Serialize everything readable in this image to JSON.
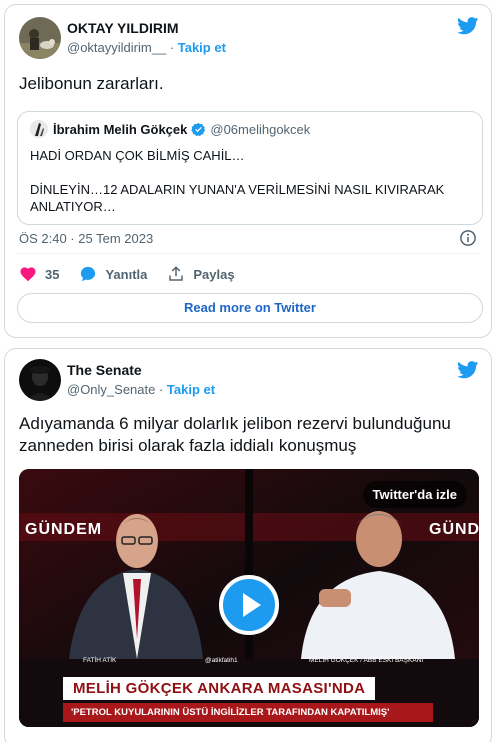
{
  "tweet1": {
    "display_name": "OKTAY YILDIRIM",
    "handle": "@oktayyildirim__",
    "separator": " · ",
    "follow_label": "Takip et",
    "text": "Jelibonun zararları.",
    "quote": {
      "display_name": "İbrahim Melih Gökçek",
      "handle": "@06melihgokcek",
      "text": "HADİ ORDAN ÇOK BİLMİŞ CAHİL…\n\nDİNLEYİN…12 ADALARIN YUNAN'A VERİLMESİNİ NASIL KIVIRARAK ANLATIYOR…"
    },
    "timestamp": "ÖS 2:40 · 25 Tem 2023",
    "likes": "35",
    "reply_label": "Yanıtla",
    "share_label": "Paylaş",
    "read_more_label": "Read more on Twitter"
  },
  "tweet2": {
    "display_name": "The Senate",
    "handle": "@Only_Senate",
    "separator": " · ",
    "follow_label": "Takip et",
    "text": "Adıyamanda 6 milyar dolarlık jelibon rezervi bulunduğunu zanneden birisi olarak fazla iddialı konuşmuş",
    "video": {
      "watch_label": "Twitter'da izle",
      "banner_title": "MELİH GÖKÇEK ANKARA MASASI'NDA",
      "banner_subtitle": "'PETROL KUYULARININ ÜSTÜ İNGİLİZLER TARAFINDAN KAPATILMIŞ'",
      "channel_left": "GÜNDEM",
      "channel_right": "GÜND",
      "caption_left": "FATİH ATİK",
      "caption_mid": "@atikfatih1",
      "caption_right": "MELİH GÖKÇEK / ABB ESKİ BAŞKANI"
    }
  },
  "colors": {
    "twitter_blue": "#1d9bf0",
    "like_pink": "#f91880",
    "border": "#cfd9de",
    "secondary_text": "#536471"
  },
  "icons": [
    "twitter-bird-icon",
    "verified-badge-icon",
    "info-icon",
    "heart-icon",
    "reply-bubble-icon",
    "share-icon",
    "play-icon"
  ]
}
